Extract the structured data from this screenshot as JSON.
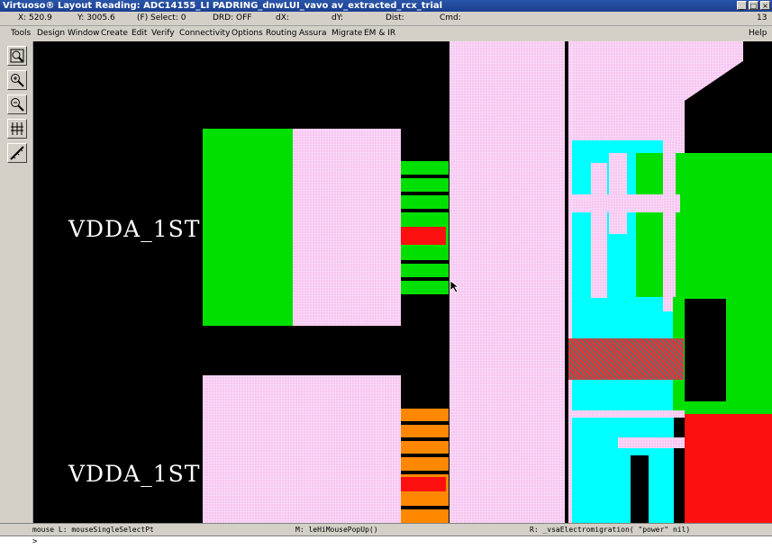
{
  "window": {
    "title": "Virtuoso® Layout Reading: ADC14155_LI PADRING_dnwLUI_vavo av_extracted_rcx_trial",
    "buttons": [
      "_",
      "□",
      "×"
    ]
  },
  "status": {
    "x": "X:  520.9",
    "y": "Y:  3005.6",
    "select": "(F) Select: 0",
    "drd": "DRD: OFF",
    "dx": "dX:",
    "dy": "dY:",
    "dist": "Dist:",
    "cmd": "Cmd:",
    "num": "13"
  },
  "menu": [
    "Tools",
    "Design",
    "Window",
    "Create",
    "Edit",
    "Verify",
    "Connectivity",
    "Options",
    "Routing",
    "Assura",
    "Migrate",
    "EM & IR"
  ],
  "help": "Help",
  "toolbar": [
    "fit-view-icon",
    "zoom-in-icon",
    "zoom-out-icon",
    "stretch-icon",
    "ruler-icon"
  ],
  "labels": {
    "pin1": "VDDA_1ST",
    "pin2": "VDDA_1ST"
  },
  "bottom": {
    "mouse_l": "mouse L: mouseSingleSelectPt",
    "mouse_m": "M: leHiMousePopUp()",
    "mouse_r": "R: _vsaElectromigration( \"power\" nil)",
    "prompt": ">"
  },
  "colors": {
    "pink": "#f7c6f2",
    "green": "#00e000",
    "cyan": "#00ffff",
    "red": "#ff1010",
    "orange": "#ff8800"
  }
}
